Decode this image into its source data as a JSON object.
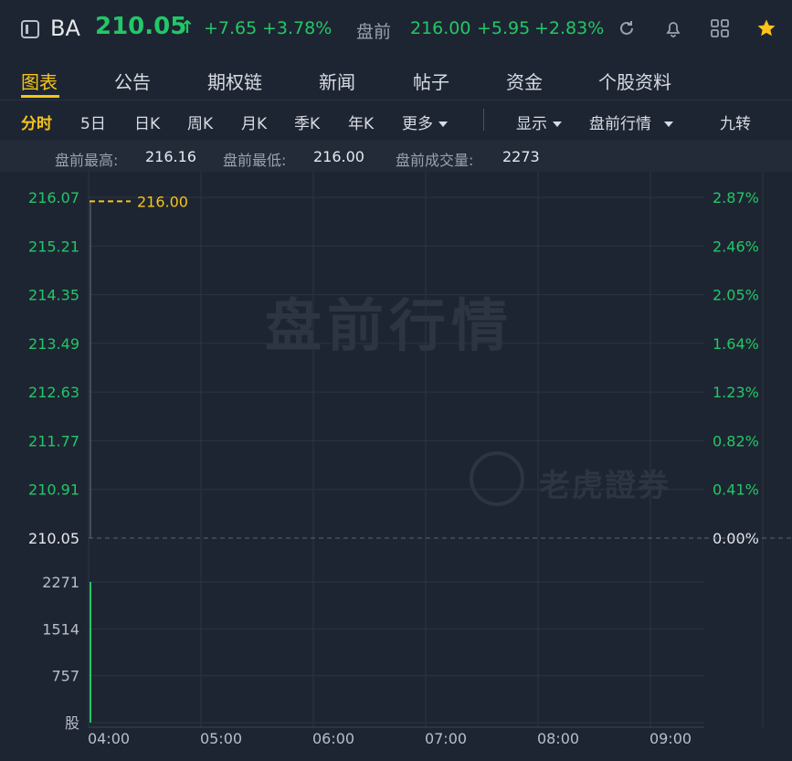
{
  "header": {
    "ticker": "BA",
    "price": "210.05",
    "arrow": "↑",
    "change": "+7.65",
    "change_pct": "+3.78%",
    "premarket_label": "盘前",
    "premarket_price": "216.00",
    "premarket_change": "+5.95",
    "premarket_change_pct": "+2.83%",
    "icons": [
      "sidebar-toggle-icon",
      "refresh-icon",
      "bell-icon",
      "grid-icon",
      "star-icon"
    ]
  },
  "tabs": [
    {
      "label": "图表",
      "active": true
    },
    {
      "label": "公告"
    },
    {
      "label": "期权链"
    },
    {
      "label": "新闻"
    },
    {
      "label": "帖子"
    },
    {
      "label": "资金"
    },
    {
      "label": "个股资料"
    }
  ],
  "periods": {
    "items": [
      "分时",
      "5日",
      "日K",
      "周K",
      "月K",
      "季K",
      "年K"
    ],
    "more": "更多",
    "display": "显示",
    "premarket_quote": "盘前行情",
    "nine_turn": "九转"
  },
  "stats": {
    "high_label": "盘前最高:",
    "high_value": "216.16",
    "low_label": "盘前最低:",
    "low_value": "216.00",
    "volume_label": "盘前成交量:",
    "volume_value": "2273"
  },
  "chart_data": {
    "type": "line",
    "watermark": "盘前行情",
    "brand": "老虎證券",
    "reference_price": "210.05",
    "current_price_label": "216.00",
    "price_ticks": [
      "216.07",
      "215.21",
      "214.35",
      "213.49",
      "212.63",
      "211.77",
      "210.91",
      "210.05"
    ],
    "pct_ticks": [
      "2.87%",
      "2.46%",
      "2.05%",
      "1.64%",
      "1.23%",
      "0.82%",
      "0.41%",
      "0.00%"
    ],
    "volume_ticks": [
      "2271",
      "1514",
      "757",
      "股"
    ],
    "time_ticks": [
      "04:00",
      "05:00",
      "06:00",
      "07:00",
      "08:00",
      "09:00"
    ],
    "series": [
      {
        "values": [
          {
            "time": "04:00",
            "price": 216.0
          }
        ]
      }
    ],
    "volume": [
      {
        "time": "04:00",
        "volume": 2273
      }
    ],
    "ylim": [
      210.05,
      216.07
    ],
    "volume_max": 2271,
    "grid": true,
    "colors": {
      "up": "#22c766",
      "price_line": "#f5c518",
      "grid": "#2c3441"
    }
  }
}
